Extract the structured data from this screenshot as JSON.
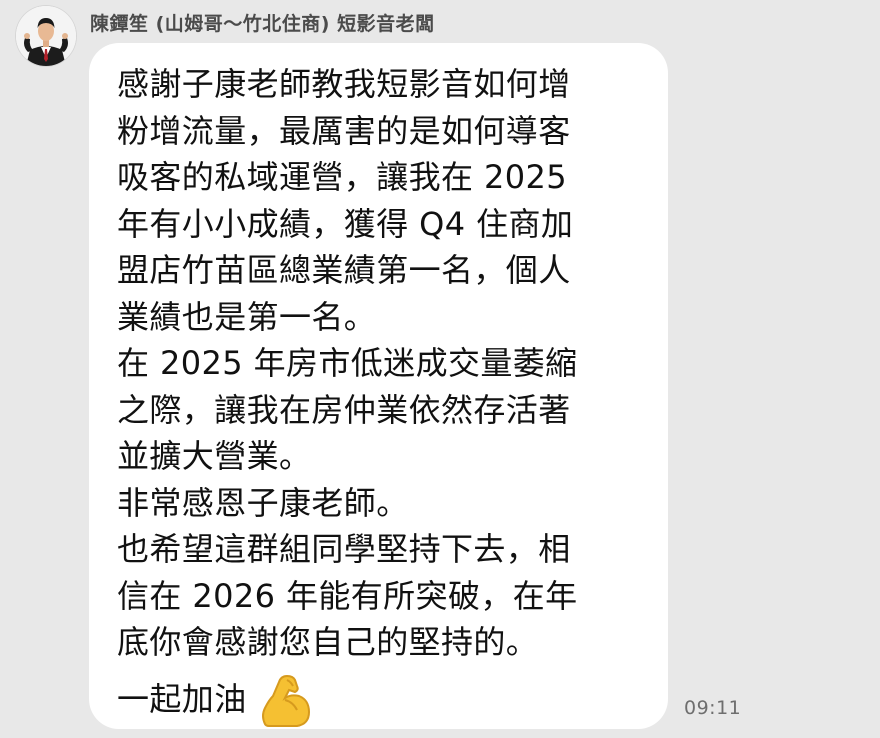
{
  "sender": {
    "name": "陳鐔笙 (山姆哥～竹北住商) 短影音老闆",
    "avatar_icon": "profile-photo-man-in-suit"
  },
  "message": {
    "body": "感謝子康老師教我短影音如何增\n粉增流量，最厲害的是如何導客\n吸客的私域運營，讓我在 2025\n年有小小成績，獲得 Q4 住商加\n盟店竹苗區總業績第一名，個人\n業績也是第一名。\n在 2025 年房市低迷成交量萎縮\n之際，讓我在房仲業依然存活著\n並擴大營業。\n非常感恩子康老師。\n也希望這群組同學堅持下去，相\n信在 2026 年能有所突破，在年\n底你會感謝您自己的堅持的。",
    "closing": "一起加油",
    "emoji_icon": "flexed-biceps-icon",
    "timestamp": "09:11"
  },
  "colors": {
    "background": "#e8e8e8",
    "bubble": "#ffffff",
    "text": "#111111",
    "sender_name": "#4b4b4b",
    "timestamp": "#6e6e6e",
    "emoji": "#f5c032"
  }
}
